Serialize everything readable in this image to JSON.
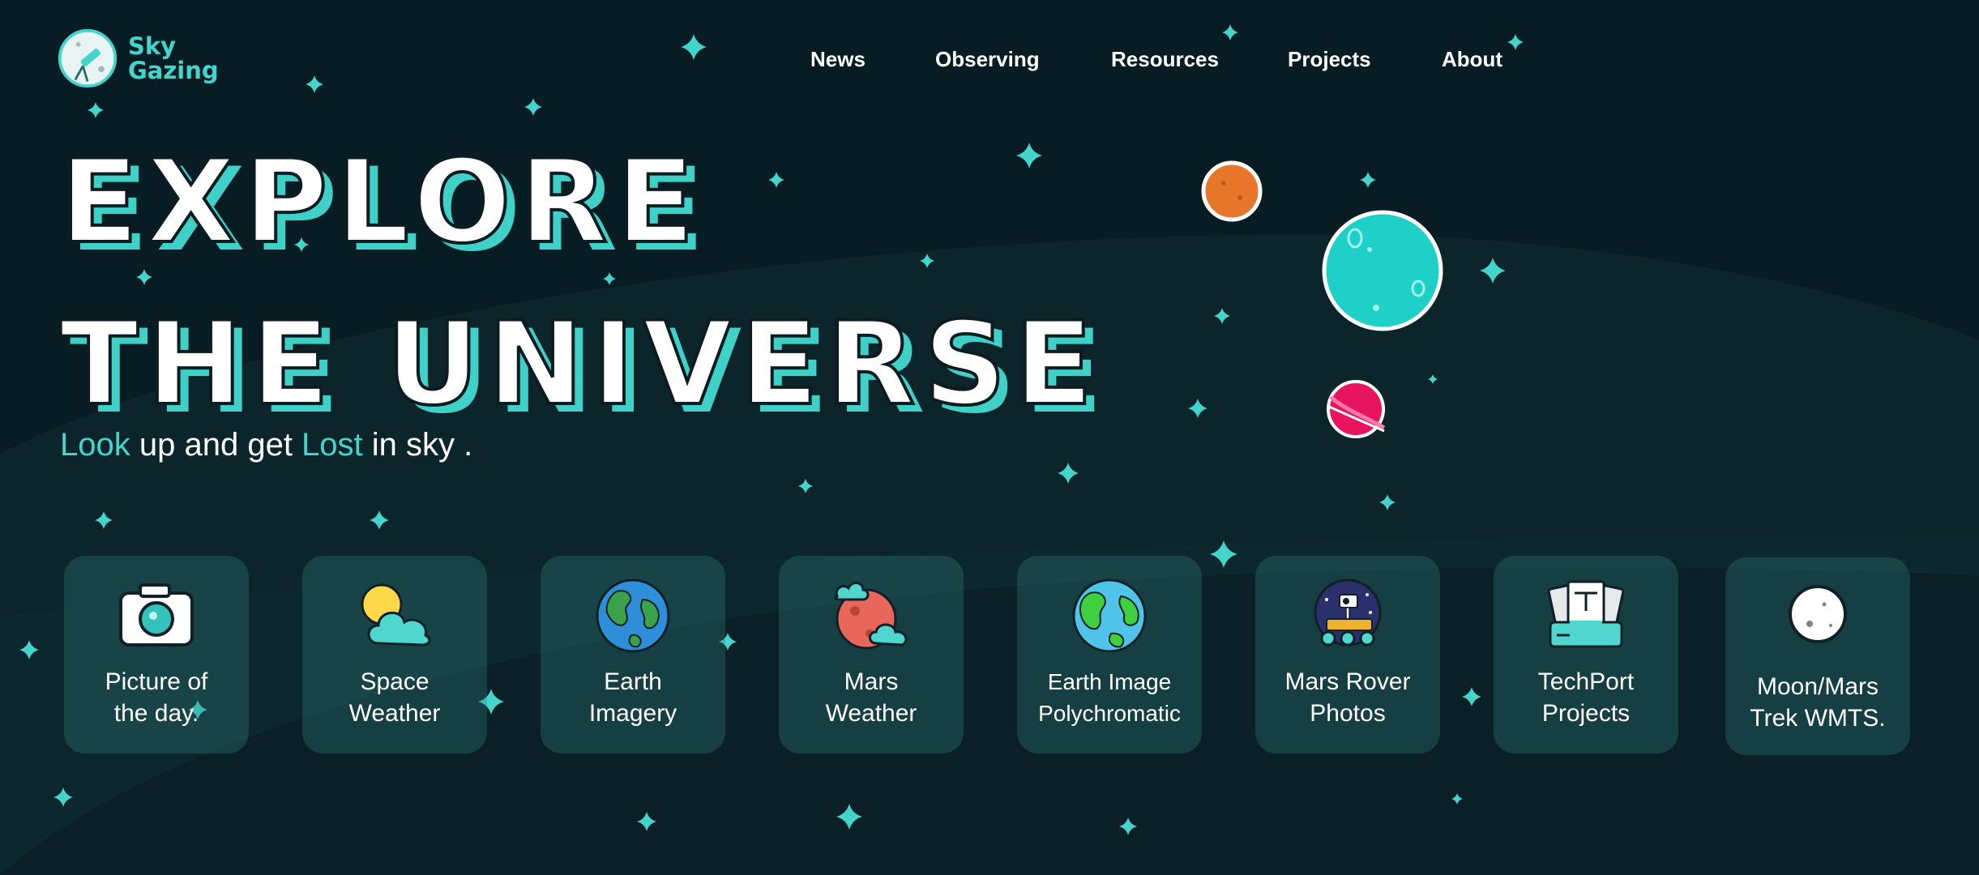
{
  "logo": {
    "line1": "Sky",
    "line2": "Gazing"
  },
  "nav": {
    "items": [
      {
        "label": "News"
      },
      {
        "label": "Observing"
      },
      {
        "label": "Resources"
      },
      {
        "label": "Projects"
      },
      {
        "label": "About"
      }
    ]
  },
  "hero": {
    "title_line1": "EXPLORE",
    "title_line2": "THE UNIVERSE",
    "tagline": {
      "word1": "Look",
      "mid1": " up and get ",
      "word2": "Lost",
      "mid2": " in sky ."
    }
  },
  "cards": [
    {
      "line1": "Picture of",
      "line2": "the day.",
      "icon": "camera-icon"
    },
    {
      "line1": "Space",
      "line2": "Weather",
      "icon": "sun-cloud-icon"
    },
    {
      "line1": "Earth",
      "line2": "Imagery",
      "icon": "earth-icon"
    },
    {
      "line1": "Mars",
      "line2": "Weather",
      "icon": "mars-cloud-icon"
    },
    {
      "line1": "Earth Image",
      "line2": "Polychromatic",
      "icon": "earth-green-icon"
    },
    {
      "line1": "Mars Rover",
      "line2": "Photos",
      "icon": "rover-icon"
    },
    {
      "line1": "TechPort",
      "line2": "Projects",
      "icon": "files-icon"
    },
    {
      "line1": "Moon/Mars",
      "line2": "Trek WMTS.",
      "icon": "moon-icon"
    }
  ],
  "colors": {
    "background": "#081d23",
    "accent": "#45d4cc",
    "card": "#1d4a4f",
    "text": "#ffffff"
  }
}
